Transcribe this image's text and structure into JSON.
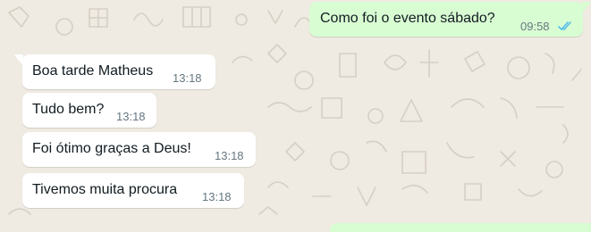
{
  "colors": {
    "wallpaper": "#efeae2",
    "incoming_bubble": "#ffffff",
    "outgoing_bubble": "#d9fdd3",
    "text": "#111b21",
    "timestamp": "#667781",
    "read_ticks": "#53bdeb"
  },
  "messages": [
    {
      "direction": "outgoing",
      "text": "Como foi o evento sábado?",
      "time": "09:58",
      "status_icon": "double-check-read-icon"
    },
    {
      "direction": "incoming",
      "text": "Boa tarde Matheus",
      "time": "13:18"
    },
    {
      "direction": "incoming",
      "text": "Tudo bem?",
      "time": "13:18"
    },
    {
      "direction": "incoming",
      "text": "Foi ótimo graças a Deus!",
      "time": "13:18"
    },
    {
      "direction": "incoming",
      "text": "Tivemos muita procura",
      "time": "13:18"
    }
  ]
}
